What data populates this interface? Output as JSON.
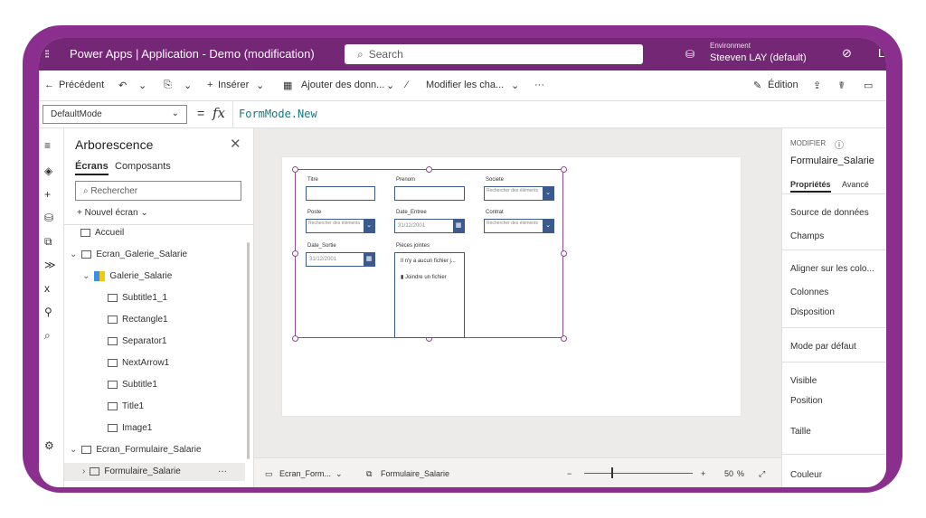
{
  "title_bar": {
    "app_title": "Power Apps | Application - Demo (modification)",
    "search_placeholder": "Search",
    "environment_label": "Environment",
    "environment_value": "Steeven LAY (default)"
  },
  "command_bar": {
    "back": "Précédent",
    "insert": "Insérer",
    "add_data": "Ajouter des donn...",
    "modify_fields": "Modifier les cha...",
    "more": "···",
    "edition": "Édition"
  },
  "formula_bar": {
    "property": "DefaultMode",
    "equals": "=",
    "fx": "fx",
    "formula": "FormMode.New"
  },
  "tree_view": {
    "title": "Arborescence",
    "tabs": [
      "Écrans",
      "Composants"
    ],
    "search_placeholder": "Rechercher",
    "new_screen": "Nouvel écran",
    "nodes": [
      "Accueil",
      "Ecran_Galerie_Salarie",
      "Galerie_Salarie",
      "Subtitle1_1",
      "Rectangle1",
      "Separator1",
      "NextArrow1",
      "Subtitle1",
      "Title1",
      "Image1",
      "Ecran_Formulaire_Salarie",
      "Formulaire_Salarie"
    ],
    "node_more": "···"
  },
  "form": {
    "fields": {
      "titre": "Titre",
      "prenom": "Prenom",
      "societe": "Societe",
      "poste": "Poste",
      "date_entree": "Date_Entree",
      "contrat": "Contrat",
      "date_sortie": "Date_Sortie",
      "pieces_jointes": "Pièces jointes"
    },
    "dropdown_placeholder": "Rechercher des éléments",
    "date_placeholder": "31/12/2001",
    "no_file": "Il n'y a aucun fichier j...",
    "attach_file": "Joindre un fichier"
  },
  "status_bar": {
    "screen": "Ecran_Form...",
    "control": "Formulaire_Salarie",
    "minus": "−",
    "plus": "+",
    "zoom": "50",
    "zoom_unit": "%"
  },
  "properties_panel": {
    "section_label": "MODIFIER",
    "control_name": "Formulaire_Salarie",
    "tabs": [
      "Propriétés",
      "Avancé"
    ],
    "items": [
      "Source de données",
      "Champs",
      "Aligner sur les colo...",
      "Colonnes",
      "Disposition",
      "Mode par défaut",
      "Visible",
      "Position",
      "Taille",
      "Couleur"
    ]
  }
}
